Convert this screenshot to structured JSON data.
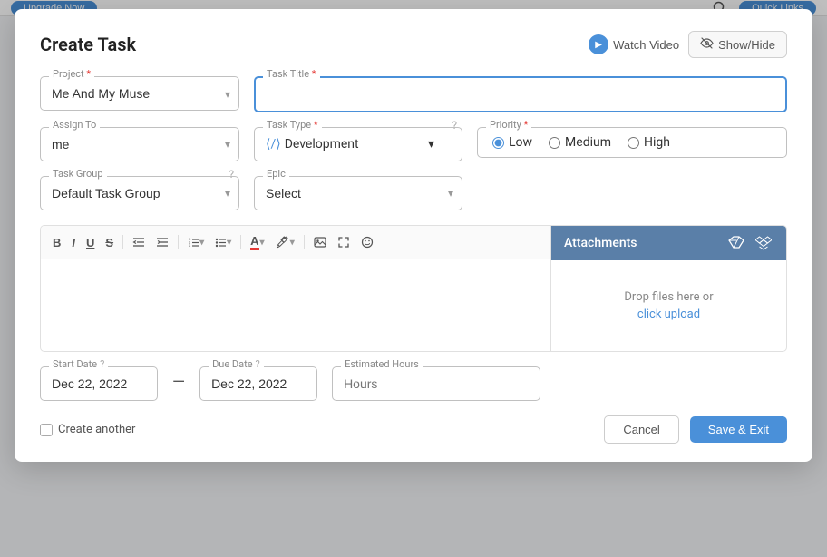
{
  "topBar": {
    "upgradeLabel": "Upgrade Now",
    "quickLinksLabel": "Quick Links"
  },
  "modal": {
    "title": "Create Task",
    "watchVideoLabel": "Watch Video",
    "showHideLabel": "Show/Hide"
  },
  "form": {
    "projectLabel": "Project",
    "projectValue": "Me And My Muse",
    "taskTitleLabel": "Task Title",
    "taskTitlePlaceholder": "",
    "assignToLabel": "Assign To",
    "assignToValue": "me",
    "taskTypeLabel": "Task Type",
    "taskTypeValue": "Development",
    "priorityLabel": "Priority",
    "priorityOptions": [
      "Low",
      "Medium",
      "High"
    ],
    "prioritySelected": "Low",
    "taskGroupLabel": "Task Group",
    "taskGroupValue": "Default Task Group",
    "epicLabel": "Epic",
    "epicValue": "Select",
    "attachmentsLabel": "Attachments",
    "dropText": "Drop files here or",
    "clickUploadLabel": "click upload",
    "startDateLabel": "Start Date",
    "startDateValue": "Dec 22, 2022",
    "dueDateLabel": "Due Date",
    "dueDateValue": "Dec 22, 2022",
    "estimatedHoursLabel": "Estimated Hours",
    "estimatedHoursPlaceholder": "Hours",
    "createAnotherLabel": "Create another",
    "cancelLabel": "Cancel",
    "saveLabel": "Save & Exit"
  }
}
